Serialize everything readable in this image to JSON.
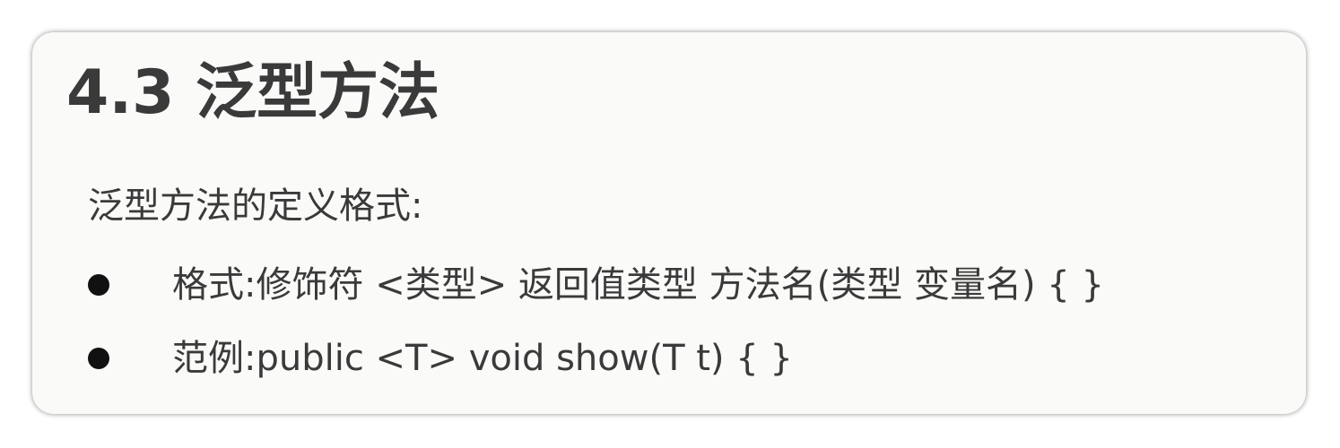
{
  "slide": {
    "title": "4.3 泛型方法",
    "subtitle": "泛型方法的定义格式:",
    "bullets": [
      {
        "text": "格式:修饰符 <类型> 返回值类型 方法名(类型 变量名) {  }"
      },
      {
        "text": "范例:public <T> void show(T t) {  }"
      }
    ]
  }
}
